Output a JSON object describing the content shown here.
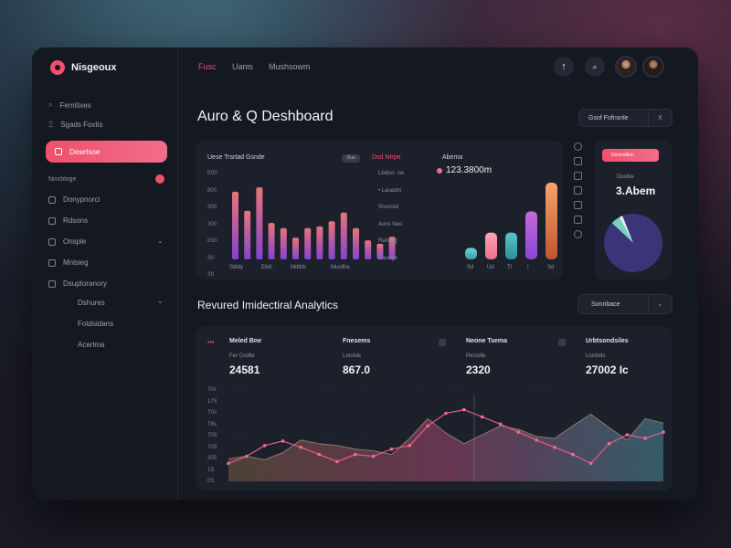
{
  "brand": {
    "name": "Nisgeoux"
  },
  "topbar": {
    "tabs": [
      {
        "label": "Fusc",
        "active": true
      },
      {
        "label": "Uanis",
        "active": false
      },
      {
        "label": "Mushsowm",
        "active": false
      }
    ],
    "buttons": [
      "upload-icon",
      "search-icon"
    ]
  },
  "sidebar": {
    "top_items": [
      "Femitixes",
      "Sgads Foxtis"
    ],
    "active_item": "Dewrlsoe",
    "section_label": "Nmrbloge",
    "items": [
      "Donypnorci",
      "Rdsons",
      "Onsple",
      "Mnlsieg",
      "Dsuptoranory"
    ],
    "sub_items": [
      "Dshures",
      "Fotdsidans",
      "Acerlma"
    ]
  },
  "page": {
    "title": "Auro & Q Deshboard",
    "filter_label": "Gsof Fofnsnle",
    "filter_icon": "X"
  },
  "bar_card": {
    "title": "Uese Trsrtad Gsnde",
    "chip": "Ous",
    "legend_title": "Dsd Ntrpe",
    "legend": [
      "Lbdrxs .ne",
      "• Laoaxtn",
      "Srosnsd",
      "Aons Neo",
      "Ranrivg",
      "Cauoge"
    ],
    "y_ticks": [
      "E00",
      "800",
      "300",
      "300",
      "8S0",
      "S0",
      "3S"
    ],
    "x_ticks": [
      "Sdldy",
      "Eblti",
      "Mdtlrb",
      "Muslllre"
    ]
  },
  "chart_data": [
    {
      "type": "bar",
      "title": "Uese Trsrtad Gsnde",
      "categories": [
        "Sdldy",
        "",
        "Eblti",
        "",
        "Mdtlrb",
        "",
        "Muslllre"
      ],
      "values": [
        78,
        56,
        83,
        42,
        36,
        25,
        36,
        38,
        44,
        54,
        36,
        22,
        18,
        26
      ],
      "colors_top": "#f2797a",
      "colors_bottom": "#8b44d8"
    },
    {
      "type": "bar",
      "title": "Abema",
      "value_label": "123.3800m",
      "categories": [
        "Sd",
        "Ud",
        "Tl",
        "I",
        "Sd",
        "Obl"
      ],
      "values": [
        12,
        28,
        28,
        50,
        80,
        95
      ]
    },
    {
      "type": "pie",
      "title": "Dosbie",
      "value_label": "3.Abem",
      "header_label": "Dsmnsltion",
      "slices": [
        {
          "name": "A",
          "value": 93
        },
        {
          "name": "B",
          "value": 5
        },
        {
          "name": "C",
          "value": 2
        }
      ]
    },
    {
      "type": "line",
      "title": "Revured Imidectiral Analytics",
      "y_ticks": [
        "70s",
        "17S",
        "T0s",
        "T8s",
        "70S",
        "70S",
        "205",
        "1S",
        "0S"
      ],
      "series": [
        {
          "values": [
            25,
            28,
            24,
            32,
            46,
            42,
            40,
            36,
            34,
            30,
            48,
            70,
            54,
            42,
            52,
            62,
            58,
            50,
            48,
            62,
            75,
            60,
            46,
            70,
            65
          ]
        },
        {
          "values": [
            20,
            28,
            40,
            45,
            38,
            30,
            22,
            30,
            28,
            36,
            40,
            62,
            76,
            80,
            72,
            64,
            55,
            46,
            38,
            30,
            20,
            42,
            52,
            48,
            55
          ]
        }
      ]
    }
  ],
  "small_chart": {
    "title": "Abema",
    "value": "123.3800m",
    "x_ticks": [
      "Sd",
      "Ud",
      "Tl",
      "I",
      "Sd",
      "Obl"
    ]
  },
  "pie_card": {
    "header": "Dsmnsltion",
    "label": "Dosbie",
    "value": "3.Abem"
  },
  "analytics": {
    "title": "Revured Imidectiral Analytics",
    "select_label": "Sonnbace",
    "stats": [
      {
        "label": "Meled Bne",
        "sub": "Fer Codlle",
        "value": "24581"
      },
      {
        "label": "Fnesems",
        "sub": "Lorulde",
        "value": "867.0"
      },
      {
        "label": "Neone Tsema",
        "sub": "Pecsdle",
        "value": "2320"
      },
      {
        "label": "Urbtsondsiles",
        "sub": "Lordsds",
        "value": "27002 Ic"
      }
    ],
    "y_ticks": [
      "70s",
      "17S",
      "T0s",
      "T8s",
      "70S",
      "70S",
      "205",
      "1S",
      "0S"
    ]
  },
  "colors": {
    "accent": "#f0506a",
    "background": "#141821",
    "card": "#1b202b"
  }
}
